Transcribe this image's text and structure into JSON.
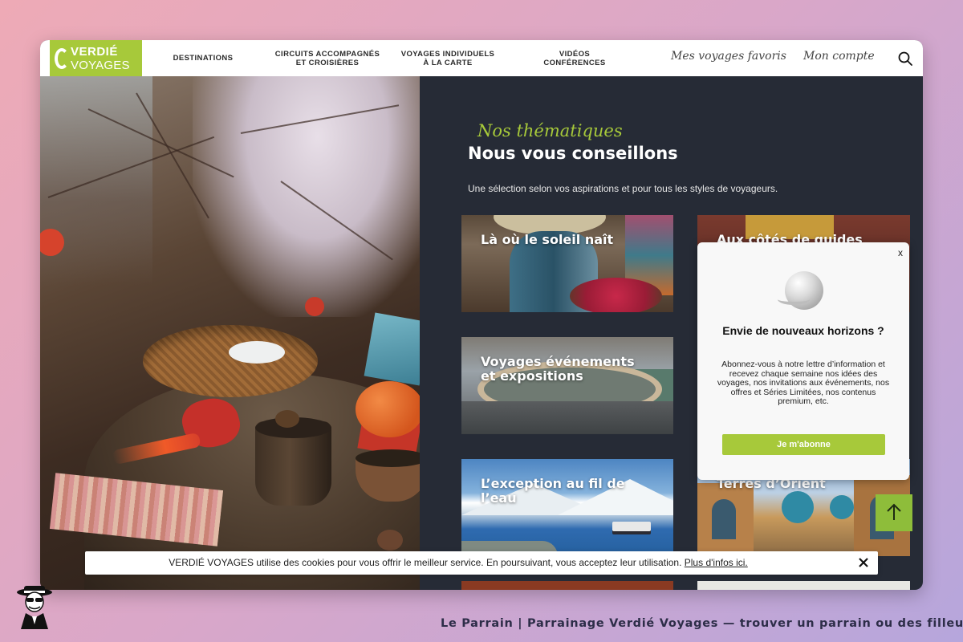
{
  "brand": {
    "line1": "VERDIÉ",
    "line2": "VOYAGES",
    "color": "#a7c93a"
  },
  "nav": {
    "items": [
      {
        "label": "DESTINATIONS"
      },
      {
        "label": "CIRCUITS ACCOMPAGNÉS ET CROISIÈRES"
      },
      {
        "label": "VOYAGES INDIVIDUELS À LA CARTE"
      },
      {
        "label": "VIDÉOS CONFÉRENCES"
      }
    ],
    "favorites": "Mes voyages favoris",
    "account": "Mon compte",
    "search_icon": "search-icon"
  },
  "section": {
    "eyebrow": "Nos thématiques",
    "title": "Nous vous conseillons",
    "subtitle": "Une sélection selon vos aspirations et pour tous les styles de voyageurs."
  },
  "cards": [
    {
      "label": "Là où le soleil naît"
    },
    {
      "label": "Aux côtés de guides"
    },
    {
      "label": "Voyages événements et expositions"
    },
    {
      "label": "L’exception au fil de l’eau"
    },
    {
      "label": "Terres d’Orient"
    }
  ],
  "popup": {
    "close": "x",
    "title": "Envie de nouveaux horizons ?",
    "text": "Abonnez-vous à notre lettre d’information et recevez chaque semaine nos idées des voyages, nos invitations aux événements, nos offres et Séries Limitées, nos contenus premium, etc.",
    "button": "Je m'abonne"
  },
  "cookie": {
    "text": "VERDIÉ VOYAGES utilise des cookies pour vous offrir le meilleur service. En poursuivant, vous acceptez leur utilisation.",
    "link": "Plus d'infos ici."
  },
  "footer": {
    "caption": "Le Parrain | Parrainage Verdié Voyages — trouver un parrain ou des filleuls"
  }
}
